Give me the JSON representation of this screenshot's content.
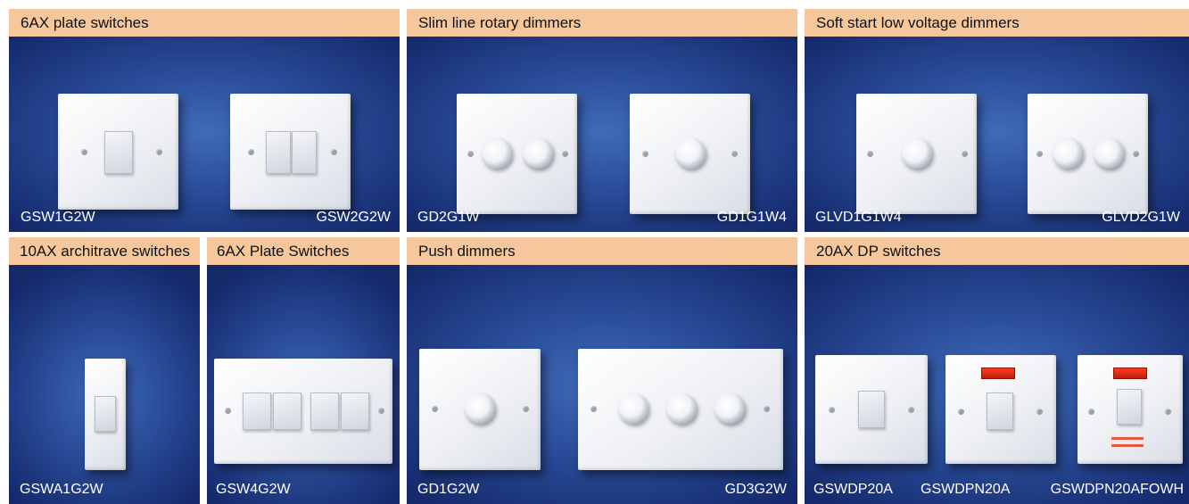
{
  "panels": {
    "plate_switches": {
      "header": "6AX plate switches",
      "left": "GSW1G2W",
      "right": "GSW2G2W"
    },
    "rotary_dimmers": {
      "header": "Slim line rotary dimmers",
      "left": "GD2G1W",
      "right": "GD1G1W4"
    },
    "lv_dimmers": {
      "header": "Soft start low voltage dimmers",
      "left": "GLVD1G1W4",
      "right": "GLVD2G1W"
    },
    "architrave": {
      "header": "10AX architrave switches",
      "left": "GSWA1G2W"
    },
    "plate_switches_4g": {
      "header": "6AX Plate Switches",
      "left": "GSW4G2W"
    },
    "push_dimmers": {
      "header": "Push dimmers",
      "left": "GD1G2W",
      "right": "GD3G2W"
    },
    "dp_switches": {
      "header": "20AX DP switches",
      "left": "GSWDP20A",
      "middle": "GSWDPN20A",
      "right": "GSWDPN20AFOWH"
    }
  }
}
